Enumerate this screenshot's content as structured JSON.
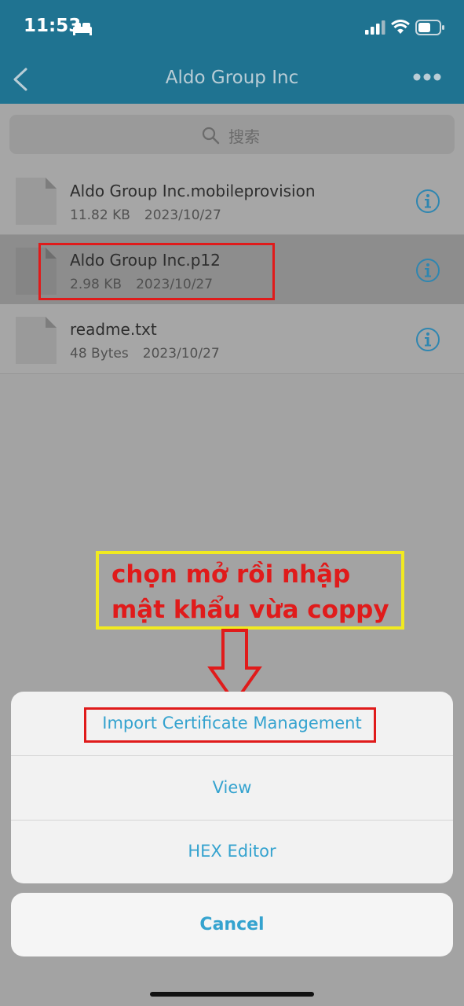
{
  "status_bar": {
    "time": "11:53"
  },
  "nav": {
    "title": "Aldo Group Inc"
  },
  "search": {
    "placeholder": "搜索"
  },
  "files": [
    {
      "name": "Aldo Group Inc.mobileprovision",
      "size": "11.82 KB",
      "date": "2023/10/27"
    },
    {
      "name": "Aldo Group Inc.p12",
      "size": "2.98 KB",
      "date": "2023/10/27"
    },
    {
      "name": "readme.txt",
      "size": "48 Bytes",
      "date": "2023/10/27"
    }
  ],
  "annotation": {
    "line1": "chọn mở rồi nhập",
    "line2": "mật khẩu vừa coppy"
  },
  "action_sheet": {
    "items": [
      "Import Certificate Management",
      "View",
      "HEX Editor"
    ],
    "cancel": "Cancel"
  },
  "colors": {
    "accent": "#35a3cf",
    "nav_bg": "#1f7391",
    "highlight": "#e01b1b",
    "note_border": "#f1ea20"
  }
}
